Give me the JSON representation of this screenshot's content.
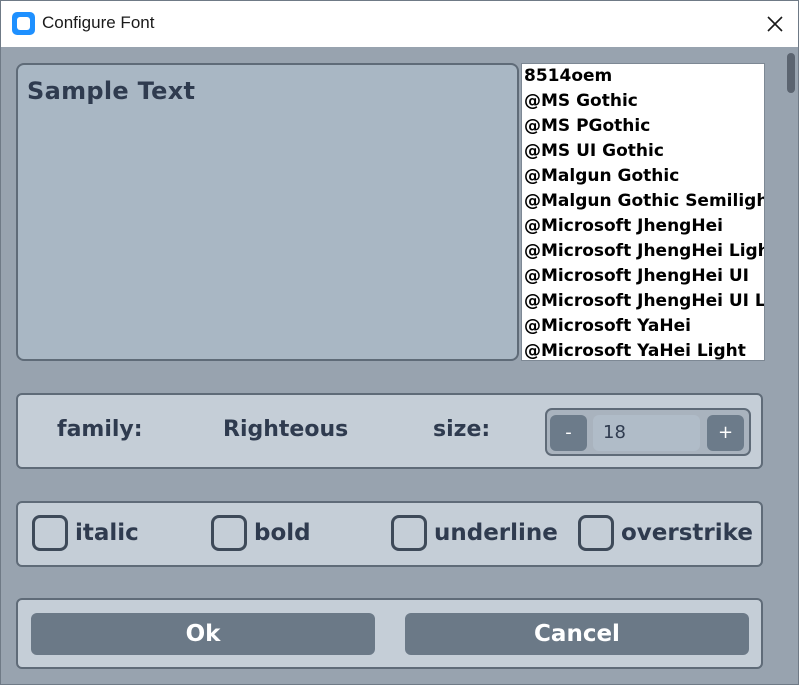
{
  "window": {
    "title": "Configure Font"
  },
  "sample": {
    "text": "Sample Text"
  },
  "font_list": {
    "items": [
      "8514oem",
      "@MS Gothic",
      "@MS PGothic",
      "@MS UI Gothic",
      "@Malgun Gothic",
      "@Malgun Gothic Semilight",
      "@Microsoft JhengHei",
      "@Microsoft JhengHei Light",
      "@Microsoft JhengHei UI",
      "@Microsoft JhengHei UI Light",
      "@Microsoft YaHei",
      "@Microsoft YaHei Light"
    ]
  },
  "family": {
    "label": "family:",
    "value": "Righteous"
  },
  "size": {
    "label": "size:",
    "value": "18",
    "minus_label": "-",
    "plus_label": "+"
  },
  "styles": {
    "italic": "italic",
    "bold": "bold",
    "underline": "underline",
    "overstrike": "overstrike"
  },
  "buttons": {
    "ok": "Ok",
    "cancel": "Cancel"
  },
  "colors": {
    "accent": "#1e90ff",
    "window_bg": "#98a3af",
    "panel_bg": "#c5ced7",
    "button_bg": "#6b7987",
    "text_dark": "#2f3b4f"
  },
  "icons": {
    "app": "app-icon",
    "close": "close-icon"
  }
}
